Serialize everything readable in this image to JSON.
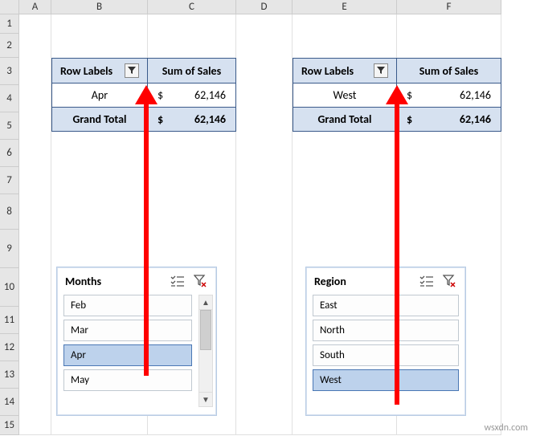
{
  "columns": [
    "A",
    "B",
    "C",
    "D",
    "E",
    "F"
  ],
  "rows": [
    "1",
    "2",
    "3",
    "4",
    "5",
    "6",
    "7",
    "8",
    "9",
    "10",
    "11",
    "12",
    "13",
    "14",
    "15"
  ],
  "pivot1": {
    "header_labels": "Row Labels",
    "header_sum": "Sum of Sales",
    "data_label": "Apr",
    "data_currency": "$",
    "data_value": "62,146",
    "total_label": "Grand Total",
    "total_currency": "$",
    "total_value": "62,146"
  },
  "pivot2": {
    "header_labels": "Row Labels",
    "header_sum": "Sum of Sales",
    "data_label": "West",
    "data_currency": "$",
    "data_value": "62,146",
    "total_label": "Grand Total",
    "total_currency": "$",
    "total_value": "62,146"
  },
  "slicer1": {
    "title": "Months",
    "items": [
      "Feb",
      "Mar",
      "Apr",
      "May"
    ],
    "selected": "Apr",
    "has_scrollbar": true
  },
  "slicer2": {
    "title": "Region",
    "items": [
      "East",
      "North",
      "South",
      "West"
    ],
    "selected": "West",
    "has_scrollbar": false
  },
  "watermark": "wsxdn.com"
}
